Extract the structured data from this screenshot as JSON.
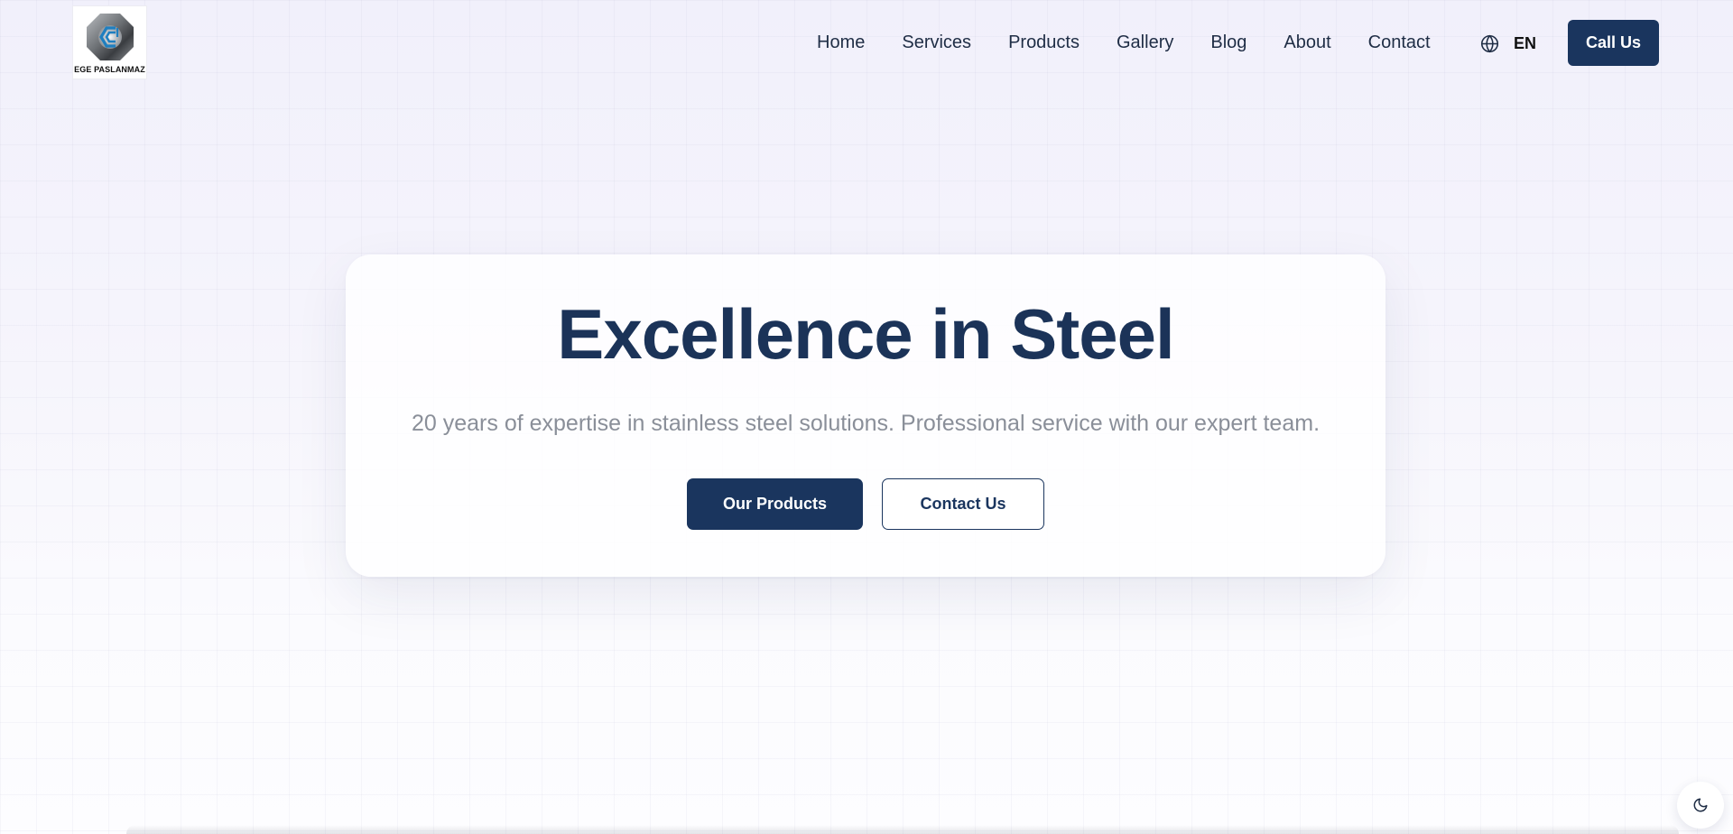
{
  "logo": {
    "text": "EGE PASLANMAZ"
  },
  "nav": {
    "items": [
      {
        "label": "Home"
      },
      {
        "label": "Services"
      },
      {
        "label": "Products"
      },
      {
        "label": "Gallery"
      },
      {
        "label": "Blog"
      },
      {
        "label": "About"
      },
      {
        "label": "Contact"
      }
    ],
    "language": {
      "code": "EN",
      "icon": "globe-icon"
    },
    "call_label": "Call Us"
  },
  "hero": {
    "title": "Excellence in Steel",
    "subtitle": "20 years of expertise in stainless steel solutions. Professional service with our expert team.",
    "primary_label": "Our Products",
    "secondary_label": "Contact Us"
  },
  "theme_toggle": {
    "icon": "moon-icon"
  },
  "colors": {
    "brand": "#1a355e",
    "subtitle": "#8a8f99",
    "background": "#f3f2fc"
  }
}
